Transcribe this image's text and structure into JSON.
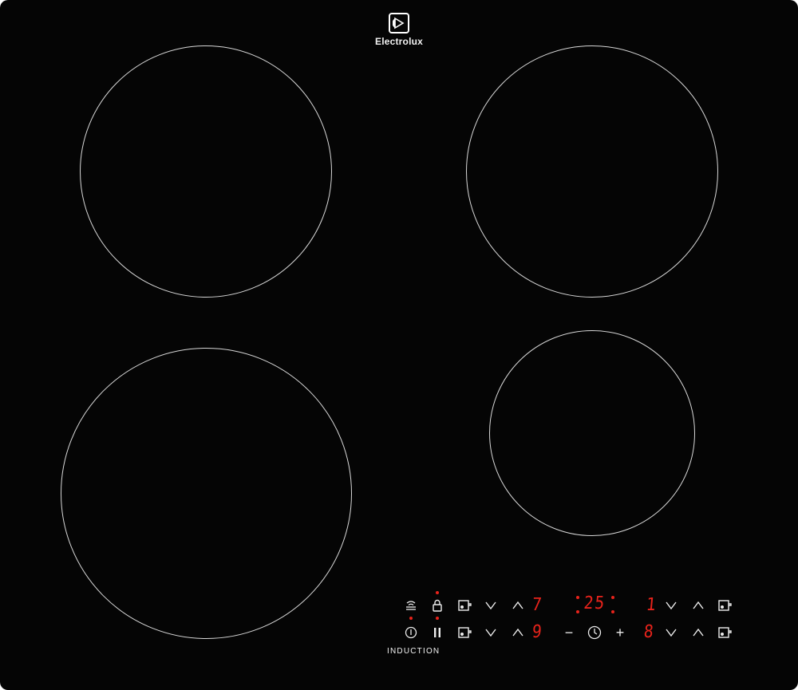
{
  "brand": {
    "name": "Electrolux"
  },
  "zones": [
    {
      "name": "rear-left",
      "interactive": false
    },
    {
      "name": "rear-right",
      "interactive": false
    },
    {
      "name": "front-left",
      "interactive": false
    },
    {
      "name": "front-right",
      "interactive": false
    }
  ],
  "panel": {
    "label": "INDUCTION",
    "rear_left_level": "7",
    "front_left_level": "9",
    "timer": "25",
    "rear_right_level": "1",
    "front_right_level": "8",
    "minus": "−",
    "plus": "+",
    "pause": "II",
    "indicator_color": "#e8231b"
  },
  "icons": {
    "hob2hood": "hob2hood-icon",
    "lock": "lock-icon",
    "power": "power-icon",
    "pause": "pause-icon",
    "zone_select": "zone-select-icon",
    "down": "chevron-down-icon",
    "up": "chevron-up-icon",
    "timer": "clock-icon"
  }
}
